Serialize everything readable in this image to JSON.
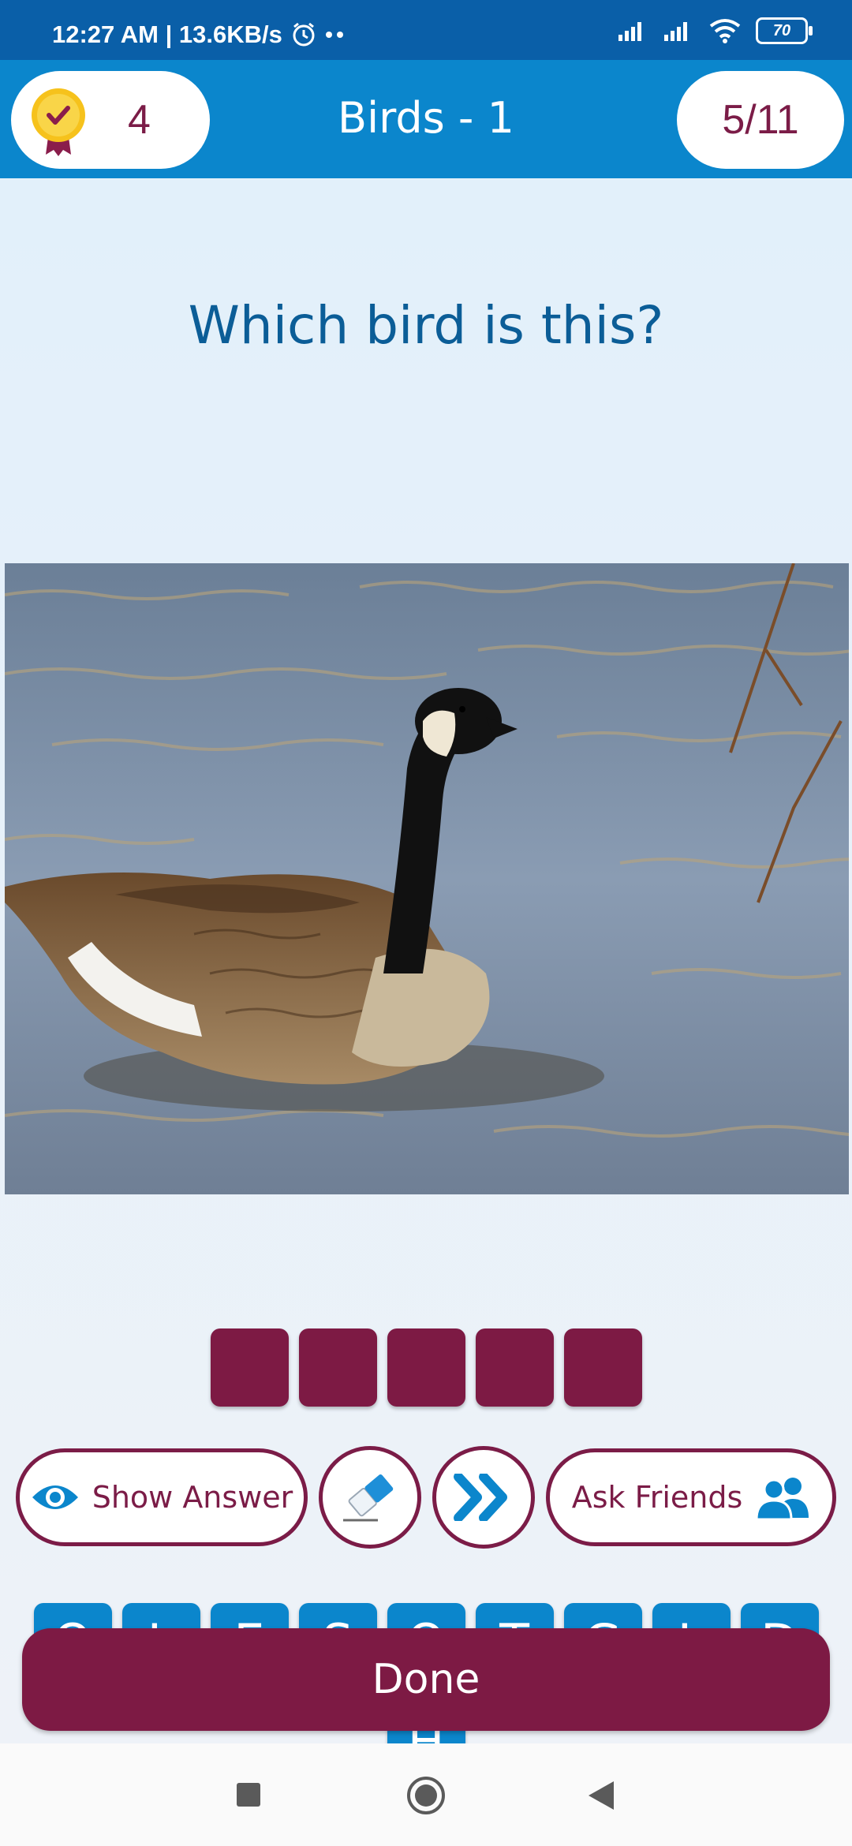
{
  "status_bar": {
    "time_and_speed": "12:27 AM | 13.6KB/s",
    "battery": "70"
  },
  "header": {
    "score": "4",
    "title": "Birds - 1",
    "progress": "5/11"
  },
  "question": "Which bird is this?",
  "answer_slots": 5,
  "actions": {
    "show_answer": "Show Answer",
    "ask_friends": "Ask Friends"
  },
  "letter_keys": {
    "row1": [
      "O",
      "L",
      "E",
      "S",
      "O",
      "T",
      "G",
      "L",
      "D"
    ],
    "row2": [
      "H"
    ]
  },
  "done_label": "Done",
  "colors": {
    "header_blue": "#0b86cc",
    "accent_maroon": "#7d1a44",
    "question_blue": "#0b5d97"
  }
}
